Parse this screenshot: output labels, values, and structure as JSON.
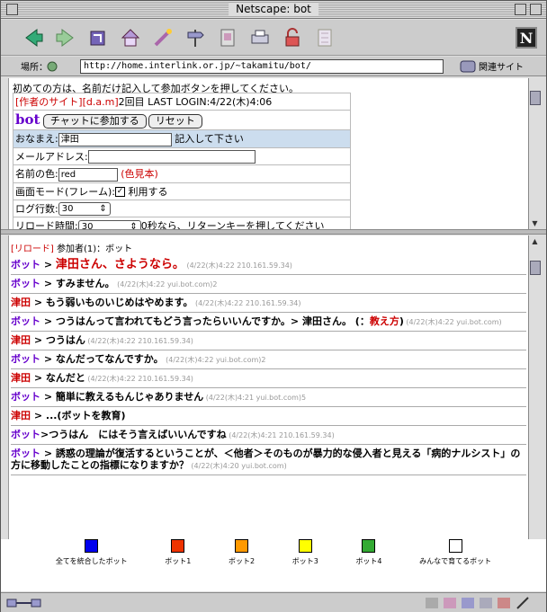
{
  "window": {
    "title": "Netscape: bot"
  },
  "location": {
    "label": "場所：",
    "url": "http://home.interlink.or.jp/~takamitu/bot/",
    "related": "関連サイト"
  },
  "colors": {
    "bot": "#6600cc",
    "tsuda": "#cc0000",
    "meta": "#999999"
  },
  "top": {
    "intro": "初めての方は、名前だけ記入して参加ボタンを押してください。",
    "author_link": "[作者のサイト]",
    "dam_link": "[d.a.m]",
    "login_info": "2回目 LAST LOGIN:4/22(木)4:06",
    "bot_title": "bot",
    "join_button": "チャットに参加する",
    "reset_button": "リセット",
    "name_label": "おなまえ:",
    "name_value": "津田",
    "name_hint": "記入して下さい",
    "mail_label": "メールアドレス:",
    "color_label": "名前の色:",
    "color_value": "red",
    "color_sample_link": "(色見本)",
    "screen_label": "画面モード(フレーム):",
    "screen_check": "✓",
    "screen_use": "利用する",
    "lines_label": "ログ行数:",
    "lines_value": "30",
    "reload_label": "リロード時間:",
    "reload_value": "30",
    "reload_hint": "0秒なら、リターンキーを押してください"
  },
  "chat": {
    "reload_link": "[リロード]",
    "participants": "参加者(1)：ボット",
    "messages": [
      {
        "name": "ボット",
        "sep": " > ",
        "text": "津田さん、さようなら。",
        "meta": " (4/22(木)4:22 210.161.59.34)",
        "big": true
      },
      {
        "name": "ボット",
        "sep": " > ",
        "text": "すみません。",
        "meta": " (4/22(木)4:22 yui.bot.com)2"
      },
      {
        "name": "津田",
        "sep": " > ",
        "text": "もう弱いものいじめはやめます。",
        "meta": " (4/22(木)4:22 210.161.59.34)"
      },
      {
        "name": "ボット",
        "sep": " > ",
        "text": "つうはんって言われてもどう言ったらいいんですか。> 津田さん。 (：",
        "link": "教え方",
        "tail": ")",
        "meta": " (4/22(木)4:22 yui.bot.com)"
      },
      {
        "name": "津田",
        "sep": " > ",
        "text": "つうはん",
        "meta": " (4/22(木)4:22 210.161.59.34)"
      },
      {
        "name": "ボット",
        "sep": " > ",
        "text": "なんだってなんですか。",
        "meta": " (4/22(木)4:22 yui.bot.com)2"
      },
      {
        "name": "津田",
        "sep": " > ",
        "text": "なんだと",
        "meta": " (4/22(木)4:22 210.161.59.34)"
      },
      {
        "name": "ボット",
        "sep": " > ",
        "text": "簡単に教えるもんじゃありません",
        "meta": " (4/22(木)4:21 yui.bot.com)5"
      },
      {
        "name": "津田",
        "sep": " > ",
        "text": "...(ボットを教育)",
        "meta": ""
      },
      {
        "name": "ボット",
        "sep": ">",
        "text": "つうはん　にはそう言えばいいんですね",
        "meta": " (4/22(木)4:21 210.161.59.34)"
      },
      {
        "name": "ボット",
        "sep": " > ",
        "text": "誘惑の理論が復活するということが、＜他者＞そのものが暴力的な侵入者と見える「病的ナルシスト」の方に移動したことの指標になりますか？",
        "meta": " (4/22(木)4:20 yui.bot.com)"
      }
    ]
  },
  "legend": [
    {
      "label": "全てを統合したボット",
      "color": "#0000ee"
    },
    {
      "label": "ボット1",
      "color": "#ee3300"
    },
    {
      "label": "ボット2",
      "color": "#ff9900"
    },
    {
      "label": "ボット3",
      "color": "#ffff00"
    },
    {
      "label": "ボット4",
      "color": "#33aa33"
    },
    {
      "label": "みんなで育てるボット",
      "color": "#ffffff"
    }
  ]
}
